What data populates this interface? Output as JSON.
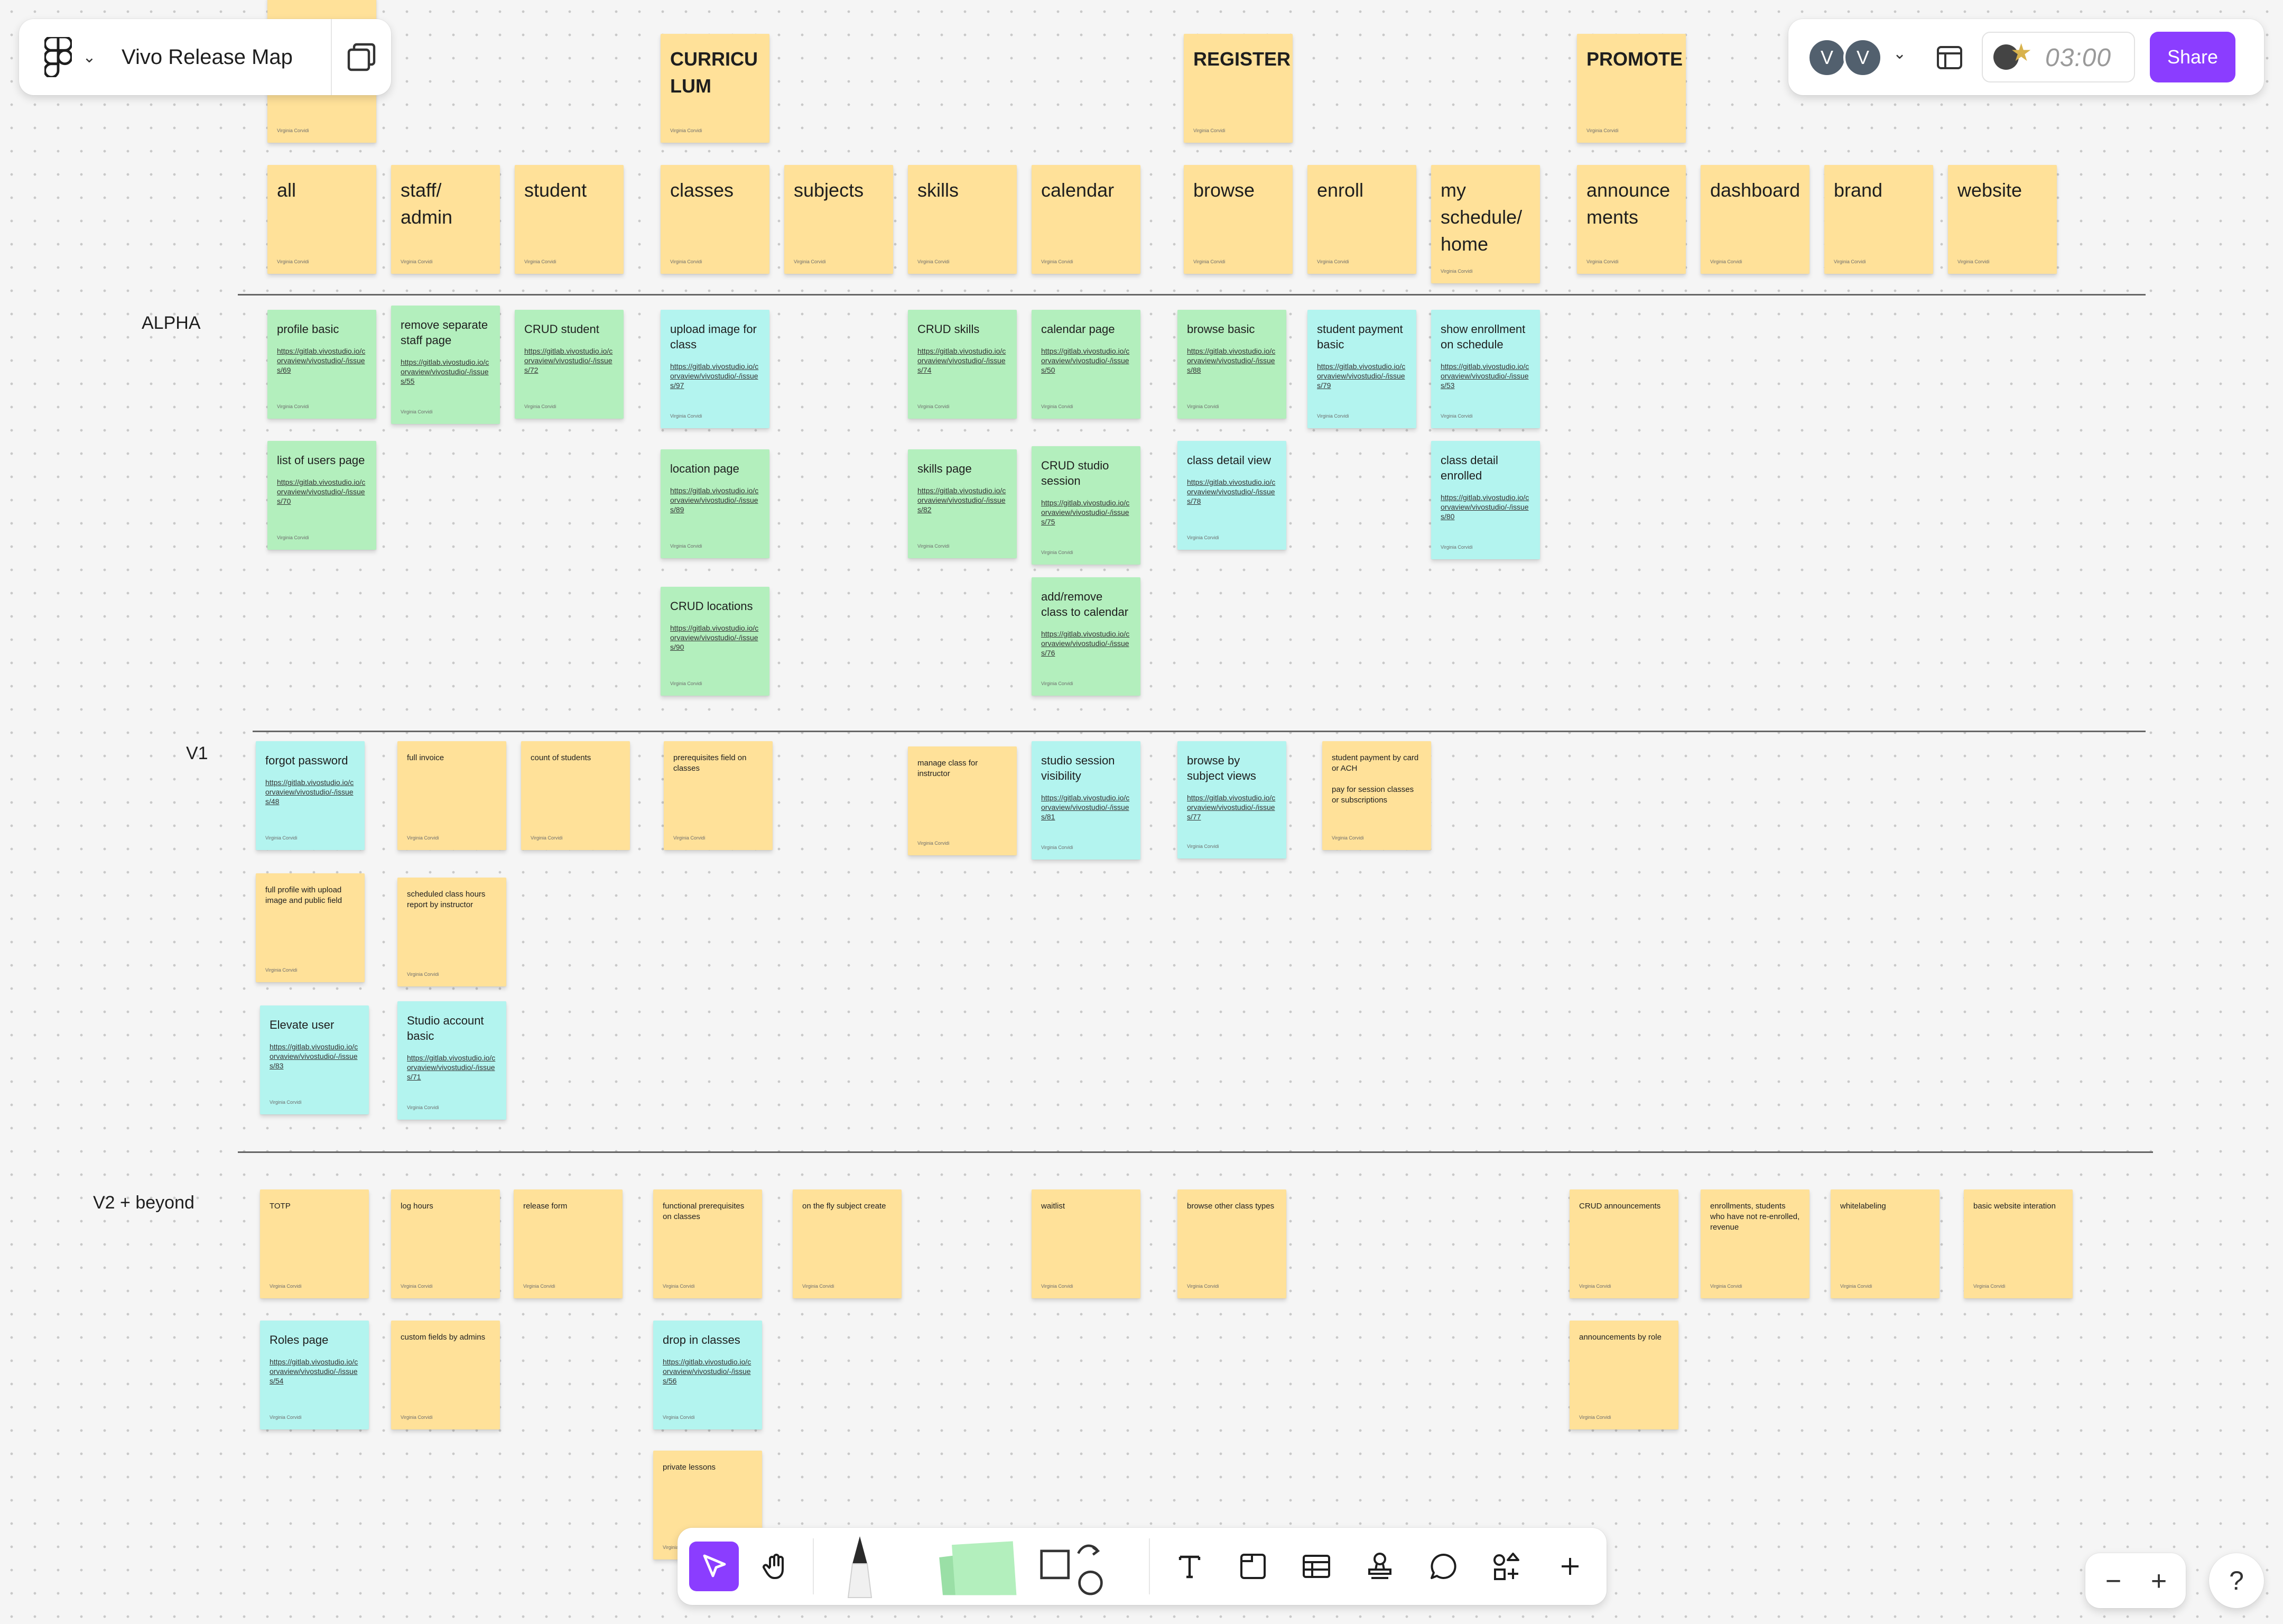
{
  "file": {
    "title": "Vivo Release Map"
  },
  "collaborators": [
    "V",
    "V"
  ],
  "timer": {
    "value": "03:00"
  },
  "share_label": "Share",
  "tools": [
    {
      "name": "select-tool",
      "icon": "cursor-icon"
    },
    {
      "name": "hand-tool",
      "icon": "hand-icon"
    },
    {
      "name": "pen-tool",
      "icon": "pen-icon"
    },
    {
      "name": "sticky-note-tool",
      "icon": "sticky-note-icon"
    },
    {
      "name": "shapes-tool",
      "icon": "shapes-icon"
    },
    {
      "name": "text-tool",
      "icon": "text-icon"
    },
    {
      "name": "section-tool",
      "icon": "section-icon"
    },
    {
      "name": "table-tool",
      "icon": "table-icon"
    },
    {
      "name": "stamp-tool",
      "icon": "stamp-icon"
    },
    {
      "name": "comment-tool",
      "icon": "comment-icon"
    },
    {
      "name": "widgets-tool",
      "icon": "widgets-icon"
    },
    {
      "name": "more-tool",
      "icon": "plus-icon"
    }
  ],
  "zoom": {
    "out": "−",
    "in": "+"
  },
  "help_label": "?",
  "row_labels": [
    "ALPHA",
    "V1",
    "V2 + beyond"
  ],
  "author": "Virginia Corvidi",
  "colors": {
    "yellow": "#ffe199",
    "green": "#b3efbd",
    "teal": "#b3f4ef",
    "accent": "#8b3dff"
  },
  "headers": [
    {
      "text": "",
      "color": "yellow"
    },
    {
      "text": "CURRICU LUM",
      "color": "yellow"
    },
    {
      "text": "REGISTER",
      "color": "yellow"
    },
    {
      "text": "PROMOTE",
      "color": "yellow"
    }
  ],
  "categories": [
    {
      "text": "all",
      "color": "yellow"
    },
    {
      "text": "staff/ admin",
      "color": "yellow"
    },
    {
      "text": "student",
      "color": "yellow"
    },
    {
      "text": "classes",
      "color": "yellow"
    },
    {
      "text": "subjects",
      "color": "yellow"
    },
    {
      "text": "skills",
      "color": "yellow"
    },
    {
      "text": "calendar",
      "color": "yellow"
    },
    {
      "text": "browse",
      "color": "yellow"
    },
    {
      "text": "enroll",
      "color": "yellow"
    },
    {
      "text": "my schedule/ home",
      "color": "yellow"
    },
    {
      "text": "announce ments",
      "color": "yellow"
    },
    {
      "text": "dashboard",
      "color": "yellow"
    },
    {
      "text": "brand",
      "color": "yellow"
    },
    {
      "text": "website",
      "color": "yellow"
    }
  ],
  "alpha": [
    {
      "text": "profile basic",
      "link": "https://gitlab.vivostudio.io/corvaview/vivostudio/-/issues/69",
      "color": "green"
    },
    {
      "text": "list of users page",
      "link": "https://gitlab.vivostudio.io/corvaview/vivostudio/-/issues/70",
      "color": "green"
    },
    {
      "text": "remove separate staff page",
      "link": "https://gitlab.vivostudio.io/corvaview/vivostudio/-/issues/55",
      "color": "green"
    },
    {
      "text": "CRUD student",
      "link": "https://gitlab.vivostudio.io/corvaview/vivostudio/-/issues/72",
      "color": "green"
    },
    {
      "text": "upload image for class",
      "link": "https://gitlab.vivostudio.io/corvaview/vivostudio/-/issues/97",
      "color": "teal"
    },
    {
      "text": "location page",
      "link": "https://gitlab.vivostudio.io/corvaview/vivostudio/-/issues/89",
      "color": "green"
    },
    {
      "text": "CRUD locations",
      "link": "https://gitlab.vivostudio.io/corvaview/vivostudio/-/issues/90",
      "color": "green"
    },
    {
      "text": "CRUD skills",
      "link": "https://gitlab.vivostudio.io/corvaview/vivostudio/-/issues/74",
      "color": "green"
    },
    {
      "text": "skills page",
      "link": "https://gitlab.vivostudio.io/corvaview/vivostudio/-/issues/82",
      "color": "green"
    },
    {
      "text": "calendar page",
      "link": "https://gitlab.vivostudio.io/corvaview/vivostudio/-/issues/50",
      "color": "green"
    },
    {
      "text": "CRUD studio session",
      "link": "https://gitlab.vivostudio.io/corvaview/vivostudio/-/issues/75",
      "color": "green"
    },
    {
      "text": "add/remove class to calendar",
      "link": "https://gitlab.vivostudio.io/corvaview/vivostudio/-/issues/76",
      "color": "green"
    },
    {
      "text": "browse basic",
      "link": "https://gitlab.vivostudio.io/corvaview/vivostudio/-/issues/88",
      "color": "green"
    },
    {
      "text": "class detail view",
      "link": "https://gitlab.vivostudio.io/corvaview/vivostudio/-/issues/78",
      "color": "teal"
    },
    {
      "text": "student payment basic",
      "link": "https://gitlab.vivostudio.io/corvaview/vivostudio/-/issues/79",
      "color": "teal"
    },
    {
      "text": "show enrollment on schedule",
      "link": "https://gitlab.vivostudio.io/corvaview/vivostudio/-/issues/53",
      "color": "teal"
    },
    {
      "text": "class detail enrolled",
      "link": "https://gitlab.vivostudio.io/corvaview/vivostudio/-/issues/80",
      "color": "teal"
    }
  ],
  "v1": [
    {
      "text": "forgot password",
      "link": "https://gitlab.vivostudio.io/corvaview/vivostudio/-/issues/48",
      "color": "teal"
    },
    {
      "text": "full profile with upload image and public field",
      "link": "",
      "color": "yellow"
    },
    {
      "text": "Elevate user",
      "link": "https://gitlab.vivostudio.io/corvaview/vivostudio/-/issues/83",
      "color": "teal"
    },
    {
      "text": "full invoice",
      "link": "",
      "color": "yellow"
    },
    {
      "text": "scheduled class hours report by instructor",
      "link": "",
      "color": "yellow"
    },
    {
      "text": "Studio account basic",
      "link": "https://gitlab.vivostudio.io/corvaview/vivostudio/-/issues/71",
      "color": "teal"
    },
    {
      "text": "count of students",
      "link": "",
      "color": "yellow"
    },
    {
      "text": "prerequisites field on classes",
      "link": "",
      "color": "yellow"
    },
    {
      "text": "manage class for instructor",
      "link": "",
      "color": "yellow"
    },
    {
      "text": "studio session visibility",
      "link": "https://gitlab.vivostudio.io/corvaview/vivostudio/-/issues/81",
      "color": "teal"
    },
    {
      "text": "browse by subject views",
      "link": "https://gitlab.vivostudio.io/corvaview/vivostudio/-/issues/77",
      "color": "teal"
    },
    {
      "text": "student payment by card or ACH\n\npay for session classes or subscriptions",
      "link": "",
      "color": "yellow"
    }
  ],
  "v2": [
    {
      "text": "TOTP",
      "link": "",
      "color": "yellow"
    },
    {
      "text": "Roles page",
      "link": "https://gitlab.vivostudio.io/corvaview/vivostudio/-/issues/54",
      "color": "teal"
    },
    {
      "text": "log hours",
      "link": "",
      "color": "yellow"
    },
    {
      "text": "custom fields by admins",
      "link": "",
      "color": "yellow"
    },
    {
      "text": "release form",
      "link": "",
      "color": "yellow"
    },
    {
      "text": "functional prerequisites on classes",
      "link": "",
      "color": "yellow"
    },
    {
      "text": "drop in classes",
      "link": "https://gitlab.vivostudio.io/corvaview/vivostudio/-/issues/56",
      "color": "teal"
    },
    {
      "text": "private lessons",
      "link": "",
      "color": "yellow"
    },
    {
      "text": "on the fly subject create",
      "link": "",
      "color": "yellow"
    },
    {
      "text": "waitlist",
      "link": "",
      "color": "yellow"
    },
    {
      "text": "browse other class types",
      "link": "",
      "color": "yellow"
    },
    {
      "text": "CRUD announcements",
      "link": "",
      "color": "yellow"
    },
    {
      "text": "announcements by role",
      "link": "",
      "color": "yellow"
    },
    {
      "text": "enrollments, students who have not re-enrolled, revenue",
      "link": "",
      "color": "yellow"
    },
    {
      "text": "whitelabeling",
      "link": "",
      "color": "yellow"
    },
    {
      "text": "basic website interation",
      "link": "",
      "color": "yellow"
    }
  ]
}
